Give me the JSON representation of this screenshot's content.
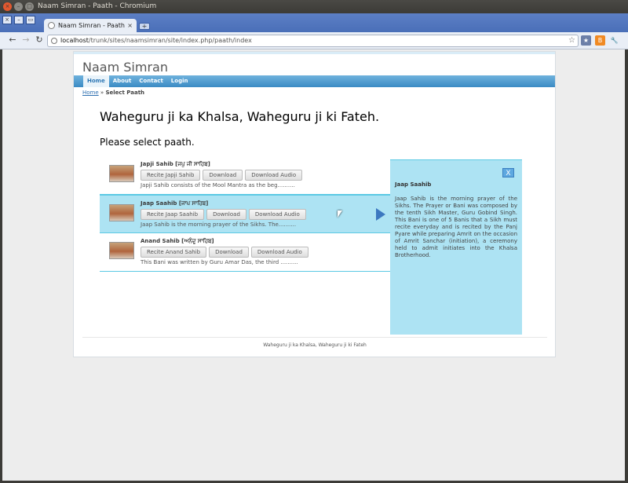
{
  "window": {
    "title": "Naam Simran - Paath - Chromium"
  },
  "browser": {
    "tab_title": "Naam Simran - Paath",
    "new_tab": "+",
    "url_host": "localhost",
    "url_path": "/trunk/sites/naamsimran/site/index.php/paath/index"
  },
  "site": {
    "name": "Naam Simran",
    "menu": [
      "Home",
      "About",
      "Contact",
      "Login"
    ],
    "breadcrumb": {
      "home": "Home",
      "sep": "»",
      "current": "Select Paath"
    },
    "heading": "Waheguru ji ka Khalsa, Waheguru ji ki Fateh.",
    "prompt": "Please select paath."
  },
  "paaths": [
    {
      "title": "Japji Sahib [ਜਪੁ ਜੀ ਸਾਹਿਬ]",
      "recite": "Recite Japji Sahib",
      "download": "Download",
      "download_audio": "Download Audio",
      "desc": "Japji Sahib consists of the Mool Mantra as the beg.........."
    },
    {
      "title": "Jaap Saahib [ਜਾਪ ਸਾਹਿਬ]",
      "recite": "Recite Jaap Saahib",
      "download": "Download",
      "download_audio": "Download Audio",
      "desc": "Jaap Sahib is the morning prayer of the Sikhs. The.........."
    },
    {
      "title": "Anand Sahib [ਅਨੰਦੁ ਸਾਹਿਬ]",
      "recite": "Recite Anand Sahib",
      "download": "Download",
      "download_audio": "Download Audio",
      "desc": "This Bani was written by Guru Amar Das, the third .........."
    }
  ],
  "panel": {
    "close": "X",
    "title": "Jaap Saahib",
    "text": "Jaap Sahib is the morning prayer of the Sikhs. The Prayer or Bani was composed by the tenth Sikh Master, Guru Gobind Singh. This Bani is one of 5 Banis that a Sikh must recite everyday and is recited by the Panj Pyare while preparing Amrit on the occasion of Amrit Sanchar (initiation), a ceremony held to admit initiates into the Khalsa Brotherhood."
  },
  "footer": "Waheguru ji ka Khalsa, Waheguru ji ki Fateh",
  "colors": {
    "menu": "#3a8ac4",
    "selected": "#ade3f3",
    "accent": "#5bc9e4"
  }
}
